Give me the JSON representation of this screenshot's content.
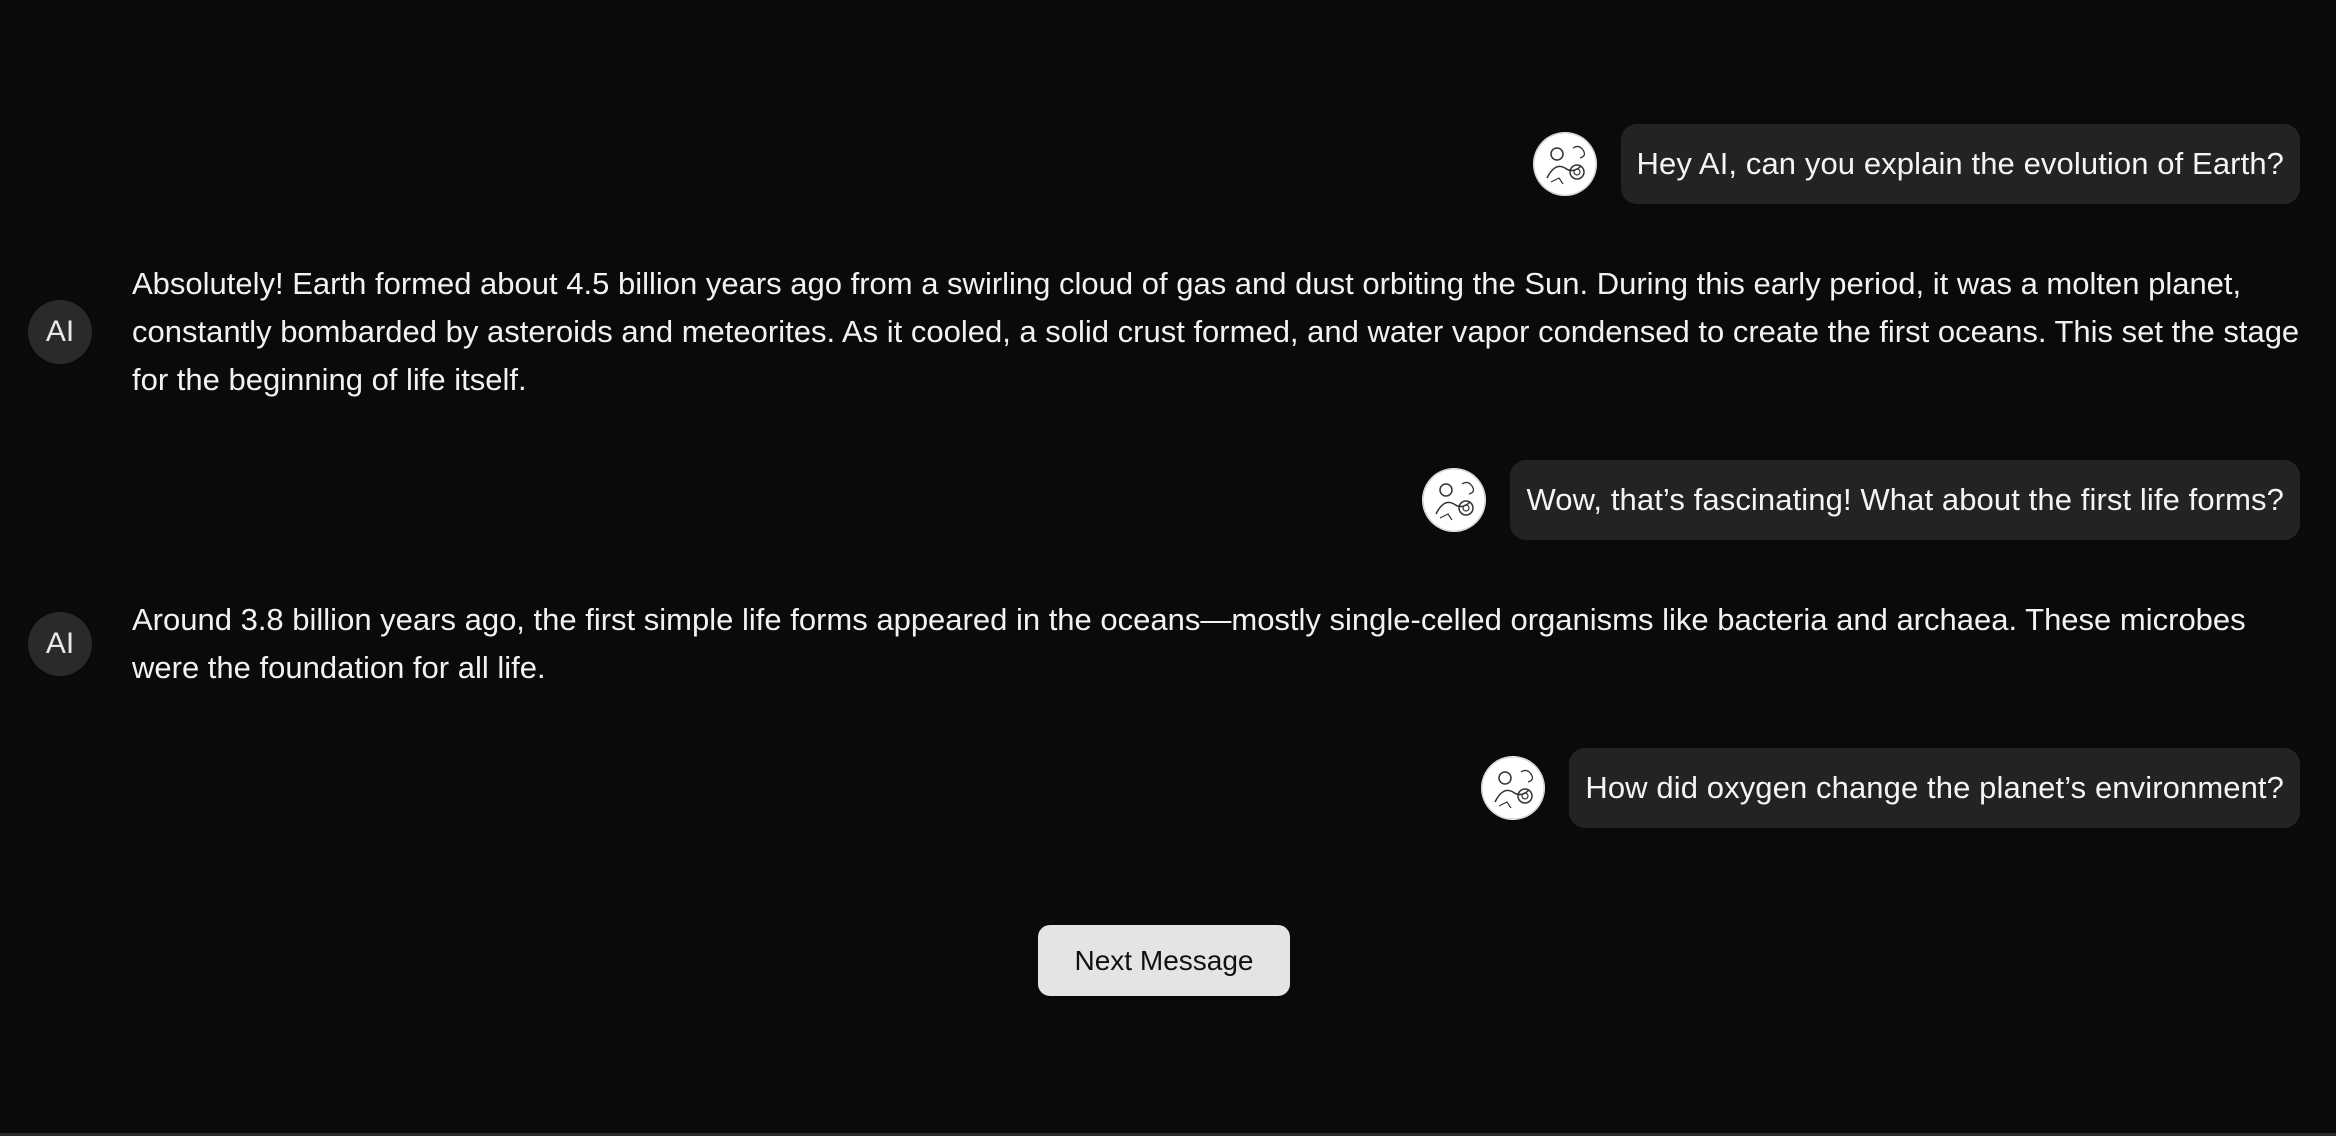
{
  "conversation": {
    "messages": [
      {
        "role": "user",
        "text": "Hey AI, can you explain the evolution of Earth?"
      },
      {
        "role": "ai",
        "avatar_label": "AI",
        "text": "Absolutely! Earth formed about 4.5 billion years ago from a swirling cloud of gas and dust orbiting the Sun. During this early period, it was a molten planet, constantly bombarded by asteroids and meteorites. As it cooled, a solid crust formed, and water vapor condensed to create the first oceans. This set the stage for the beginning of life itself."
      },
      {
        "role": "user",
        "text": "Wow, that’s fascinating! What about the first life forms?"
      },
      {
        "role": "ai",
        "avatar_label": "AI",
        "text": "Around 3.8 billion years ago, the first simple life forms appeared in the oceans—mostly single-celled organisms like bacteria and archaea. These microbes were the foundation for all life."
      },
      {
        "role": "user",
        "text": "How did oxygen change the planet’s environment?"
      }
    ]
  },
  "controls": {
    "next_label": "Next Message"
  },
  "colors": {
    "background": "#0a0a0a",
    "bubble": "#232323",
    "button": "#e4e4e4"
  },
  "icons": {
    "user_avatar": "user-avatar-illustration-icon"
  }
}
